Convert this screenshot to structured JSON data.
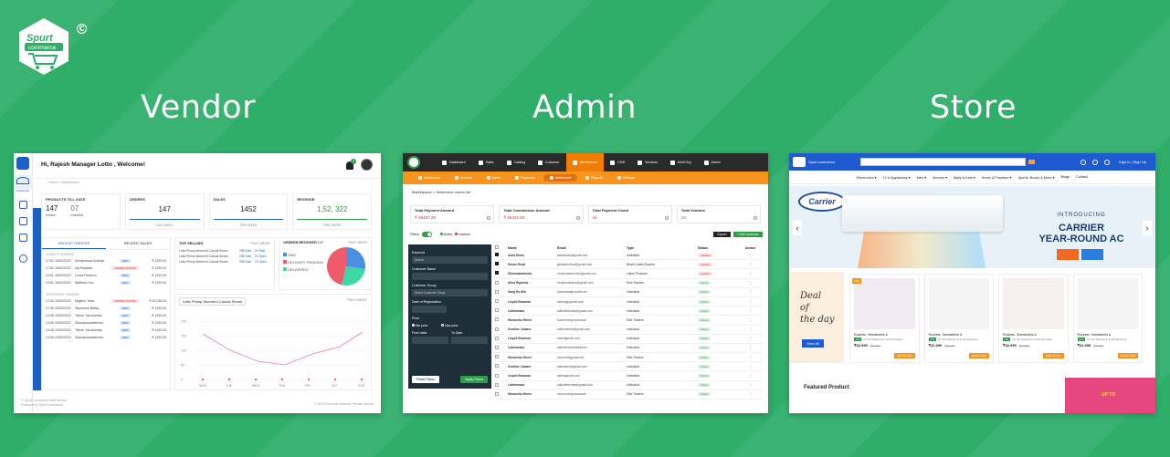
{
  "titles": {
    "vendor": "Vendor",
    "admin": "Admin",
    "store": "Store"
  },
  "logo": {
    "line1": "Spurt",
    "line2": "commerce",
    "copyright": "C"
  },
  "vendor": {
    "greeting": "Hi, Rajesh  Manager Lotto , Welcome!",
    "notif_count": "3",
    "breadcrumb": "Home / Dashboard",
    "side_label": "Dashboard",
    "cards": [
      {
        "label": "PRODUCTS TILL DATE",
        "v1": "147",
        "v1_sub": "Active",
        "v2": "07",
        "v2_sub": "Inactive"
      },
      {
        "label": "ORDERS",
        "value": "147",
        "foot": "TWO WEEK"
      },
      {
        "label": "SALES",
        "value": "1452",
        "foot": "TWO WEEK"
      },
      {
        "label": "REVENUE",
        "value": "1,52, 322",
        "foot": "TWO WEEK"
      }
    ],
    "tabs": [
      "RECENT ORDERS",
      "RECENT SALES"
    ],
    "sections": [
      "TODAY'S ORDERS",
      "YESTERDAY ORDERS"
    ],
    "orders_today": [
      {
        "t": "17:52",
        "d": "16/02/2022",
        "n": "Devaprasad Achanju",
        "s": "PAID",
        "a": "₹ 1200.00"
      },
      {
        "t": "17:52",
        "d": "16/02/2022",
        "n": "Iraj Paidwan",
        "s": "ORDER PLACED",
        "a": "₹ 1200.00"
      },
      {
        "t": "13:51",
        "d": "16/02/2022",
        "n": "Lucas Pacheco",
        "s": "PAID",
        "a": "₹ 1200.00"
      },
      {
        "t": "13:51",
        "d": "16/02/2022",
        "n": "Matthew Gra",
        "s": "PAID",
        "a": "₹ 1200.00"
      }
    ],
    "orders_yest": [
      {
        "t": "17:40",
        "d": "15/02/2022",
        "n": "Migleno Tadic",
        "s": "ORDER PLACED",
        "a": "₹ 20,236.00"
      },
      {
        "t": "17:40",
        "d": "15/02/2022",
        "n": "Stephanie Bailey",
        "s": "PAID",
        "a": "₹ 1200.00"
      },
      {
        "t": "13:08",
        "d": "15/02/2022",
        "n": "Tikhon Yaroslavsky",
        "s": "PAID",
        "a": "₹ 1200.00"
      },
      {
        "t": "13:08",
        "d": "15/02/2022",
        "n": "Zhanasnaudalimma",
        "s": "PAID",
        "a": "₹ 1200.00"
      },
      {
        "t": "13:08",
        "d": "15/02/2022",
        "n": "Tikhon Yaroslavsky",
        "s": "PAID",
        "a": "₹ 1200.00"
      },
      {
        "t": "13:08",
        "d": "15/02/2022",
        "n": "Zhanasnaudalimma",
        "s": "PAID",
        "a": "₹ 1200.00"
      }
    ],
    "top_selling": {
      "title": "TOP SELLING",
      "filter": "TWO WEEK",
      "items": [
        {
          "name": "Lotto Plump Women's Casual Shoes",
          "sold": "258 Sold",
          "status": "22 Paid"
        },
        {
          "name": "Lotto Plump Women's Casual Shoes",
          "sold": "258 Sold",
          "status": "22 Open"
        },
        {
          "name": "Lotto Plump Women's Casual Shoes",
          "sold": "258 Sold",
          "status": "22 Open"
        }
      ]
    },
    "orders_received": {
      "title": "ORDERS RECEIVED",
      "count": "147",
      "filter": "TWO WEEK",
      "legend": [
        "PAID",
        "DELIVERY PENDING",
        "DELIVERED"
      ]
    },
    "line_chart": {
      "title": "Lotto Plump Women's Casual Shoes",
      "filter": "TWO WEEK",
      "ylabels": [
        "200",
        "150",
        "100",
        "50",
        "0"
      ],
      "xlabels": [
        "MON",
        "TUE",
        "WED",
        "THU",
        "FRI",
        "SAT",
        "SUN"
      ]
    },
    "footer": [
      "© Spurt Commerce Multi Vendor",
      "Powered by Spurt Commerce"
    ],
    "copyright": "© 2019 Piccosoft Software Private Limited"
  },
  "admin": {
    "menu": [
      "Dashboard",
      "Sales",
      "Catalog",
      "Customer",
      "Marketplace",
      "CMS",
      "Services",
      "Multi Org",
      "Admin"
    ],
    "submenu": [
      "Dashboard",
      "Vendors",
      "Sales",
      "Payments",
      "Settlement",
      "Reports",
      "Settings"
    ],
    "breadcrumb": "Marketplace  >  Settlement orders list",
    "stats": [
      {
        "label": "Total Payment Amount",
        "value": "₹ 56487.28"
      },
      {
        "label": "Total Commission Amount",
        "value": "₹ 56432.83"
      },
      {
        "label": "Total Payment Count",
        "value": "44"
      },
      {
        "label": "Total Vendors",
        "value": "13"
      }
    ],
    "filters_label": "Filters",
    "active": "Active",
    "inactive": "Inactive",
    "export": "Export",
    "add": "+ Add customer",
    "filter_panel": {
      "keyword": "Keyword",
      "search": "Search",
      "customer_name": "Customer Name",
      "customer_group": "Customer Group",
      "group_select": "Select Customer Group",
      "date_reg": "Date of Registration",
      "price": "Price",
      "min": "Min price",
      "max": "Max price",
      "from": "From date",
      "to": "To Date",
      "reset": "Reset Filters",
      "apply": "Apply Filters"
    },
    "columns": [
      "Name",
      "Email",
      "Type",
      "Status",
      "Action"
    ],
    "rows": [
      {
        "n": "Asha Dinas",
        "e": "ashadinas@gmail.com",
        "t": "Individual",
        "s": "Inactive",
        "c": true
      },
      {
        "n": "Simon Read",
        "e": "jjastalmedical@gmail.com",
        "t": "Bhavi Ladies Exports",
        "s": "Inactive",
        "c": true
      },
      {
        "n": "Zhoanaasdmmia",
        "e": "zhoanaasdmmia@gmail.com",
        "t": "Lakes Products",
        "s": "Inactive",
        "c": true
      },
      {
        "n": "Alina Ryprinia",
        "e": "fredynnabrisca@gmail.com",
        "t": "Eme Exports",
        "s": "Active",
        "c": false
      },
      {
        "n": "Sang Ho Min",
        "e": "lonneswallgmpoidcom",
        "t": "Individual",
        "s": "Active",
        "c": false
      },
      {
        "n": "Lispell Bowman",
        "e": "lasthaigpganeil.com",
        "t": "Individual",
        "s": "Active",
        "c": false
      },
      {
        "n": "Lakshmana",
        "e": "adikmiliferrata@gmail.com",
        "t": "Individual",
        "s": "Active",
        "c": false
      },
      {
        "n": "Himanshu Hinen",
        "e": "bocenneeigmpoisaom",
        "t": "Elite Traders",
        "s": "Active",
        "c": false
      },
      {
        "n": "Gunther Jubane",
        "e": "adiimrlemlet@gmail.com",
        "t": "Individual",
        "s": "Active",
        "c": false
      },
      {
        "n": "Lispell Bowman",
        "e": "lasthaigmail.com",
        "t": "Individual",
        "s": "Active",
        "c": false
      },
      {
        "n": "Lakshmana",
        "e": "adimilleradimilleradom",
        "t": "Individual",
        "s": "Active",
        "c": false
      },
      {
        "n": "Himanshu Hinen",
        "e": "bocenneiigpmaicom",
        "t": "Elite Traders",
        "s": "Active",
        "c": false
      },
      {
        "n": "Gunther Jubane",
        "e": "adimiiteeratigmail.com",
        "t": "Individual",
        "s": "Active",
        "c": false
      },
      {
        "n": "Lispell Bowman",
        "e": "lasthaigmail.com",
        "t": "Individual",
        "s": "Active",
        "c": false
      },
      {
        "n": "Lakshmana",
        "e": "adikmiliferrata@gmail.com",
        "t": "Individual",
        "s": "Active",
        "c": false
      },
      {
        "n": "Himanshu Hinen",
        "e": "bocenneeigmpoisaom",
        "t": "Elite Traders",
        "s": "Active",
        "c": false
      }
    ]
  },
  "store": {
    "brand": "Spurt commerce",
    "signin": "Sign In | Sign Up",
    "menu": [
      "Electronics ▾",
      "Tv & Appliances ▾",
      "Men ▾",
      "Women ▾",
      "Baby & Kids ▾",
      "Home & Furniture ▾",
      "Sports, Books & More ▾",
      "Blogs",
      "Contact"
    ],
    "banner": {
      "brand": "Carrier",
      "intro": "INTRODUCING",
      "l1": "CARRIER",
      "l2": "YEAR-ROUND AC"
    },
    "deal": {
      "l1": "Deal",
      "l2": "of",
      "l3": "the day",
      "btn": "View All"
    },
    "products": [
      {
        "name": "Rockets, Sweatshirts &",
        "rating": "4.6",
        "reviews": "70,721 Ratings & 4,232 Reviews",
        "price": "₹32,999",
        "old": "₹44,999",
        "off": "10%",
        "btn": "Add to Cart"
      },
      {
        "name": "Rockets, Sweatshirts &",
        "rating": "4.6",
        "reviews": "70,721 Ratings & 4,232 Reviews",
        "price": "₹32,999",
        "old": "₹44,999",
        "off": "",
        "btn": "Add to Cart"
      },
      {
        "name": "Rockets, Sweatshirts &",
        "rating": "4.6",
        "reviews": "70,721 Ratings & 4,232 Reviews",
        "price": "₹32,999",
        "old": "₹44,999",
        "off": "",
        "btn": "Add to Cart"
      },
      {
        "name": "Rockets, Sweatshirts &",
        "rating": "4.6",
        "reviews": "70,721 Ratings & 4,232 Reviews",
        "price": "₹32,999",
        "old": "₹44,999",
        "off": "",
        "btn": "Add to Cart"
      }
    ],
    "featured": "Featured Product",
    "promo": "UP TO"
  }
}
